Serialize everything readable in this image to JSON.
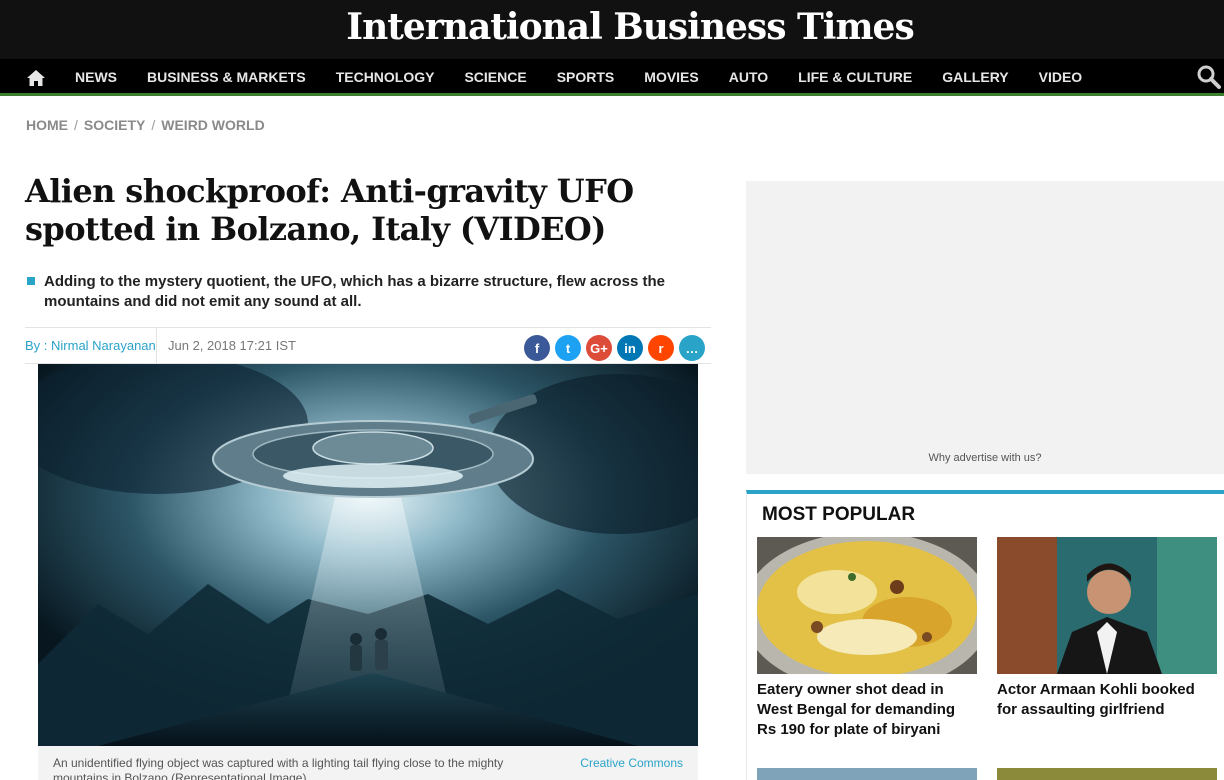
{
  "brand": "International Business Times",
  "nav": {
    "home_icon": "home-icon",
    "items": [
      "NEWS",
      "BUSINESS & MARKETS",
      "TECHNOLOGY",
      "SCIENCE",
      "SPORTS",
      "MOVIES",
      "AUTO",
      "LIFE & CULTURE",
      "GALLERY",
      "VIDEO"
    ],
    "search_icon": "search-icon"
  },
  "breadcrumb": [
    "HOME",
    "SOCIETY",
    "WEIRD WORLD"
  ],
  "breadcrumb_separator": "/",
  "article": {
    "headline": "Alien shockproof: Anti-gravity UFO spotted in Bolzano, Italy (VIDEO)",
    "summary": "Adding to the mystery quotient, the UFO, which has a bizarre structure, flew across the mountains and did not emit any sound at all.",
    "author": "By : Nirmal Narayanan",
    "date": "Jun 2, 2018 17:21 IST",
    "share_buttons": [
      {
        "name": "facebook-share-button",
        "glyph": "f",
        "color": "#3b5998"
      },
      {
        "name": "twitter-share-button",
        "glyph": "t",
        "color": "#1da1f2"
      },
      {
        "name": "google-plus-share-button",
        "glyph": "G+",
        "color": "#dd4b39"
      },
      {
        "name": "linkedin-share-button",
        "glyph": "in",
        "color": "#0077b5"
      },
      {
        "name": "reddit-share-button",
        "glyph": "r",
        "color": "#ff4500"
      },
      {
        "name": "comment-share-button",
        "glyph": "…",
        "color": "#2aa3c9"
      }
    ],
    "image_caption": "An unidentified flying object was captured with a lighting tail flying close to the mighty mountains in Bolzano (Representational Image)",
    "image_credit": "Creative Commons"
  },
  "sidebar": {
    "ad_link": "Why advertise with us?",
    "most_popular": {
      "title": "MOST POPULAR",
      "items": [
        {
          "headline": "Eatery owner shot dead in West Bengal for demanding Rs 190 for plate of biryani"
        },
        {
          "headline": "Actor Armaan Kohli booked for assaulting girlfriend"
        }
      ]
    }
  },
  "colors": {
    "masthead": "#111111",
    "nav_underline": "#3d7d2e",
    "accent": "#2aa3c9"
  }
}
